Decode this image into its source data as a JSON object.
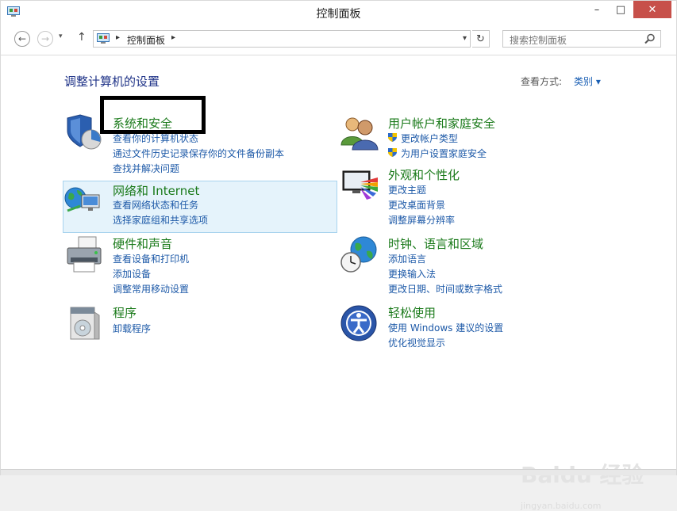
{
  "window": {
    "title": "控制面板"
  },
  "titlebar": {
    "minimize": "–",
    "maximize": "□",
    "close": "✕"
  },
  "address": {
    "back": "←",
    "forward": "→",
    "dropdown": "▾",
    "up": "↑",
    "path": "控制面板",
    "sep": "▸",
    "refresh": "↻"
  },
  "search": {
    "placeholder": "搜索控制面板"
  },
  "main": {
    "heading": "调整计算机的设置",
    "view_by_label": "查看方式:",
    "view_by_value": "类别 ▾"
  },
  "categories": {
    "system": {
      "title": "系统和安全",
      "links": [
        "查看你的计算机状态",
        "通过文件历史记录保存你的文件备份副本",
        "查找并解决问题"
      ]
    },
    "network": {
      "title": "网络和 Internet",
      "links": [
        "查看网络状态和任务",
        "选择家庭组和共享选项"
      ]
    },
    "hardware": {
      "title": "硬件和声音",
      "links": [
        "查看设备和打印机",
        "添加设备",
        "调整常用移动设置"
      ]
    },
    "programs": {
      "title": "程序",
      "links": [
        "卸载程序"
      ]
    },
    "users": {
      "title": "用户帐户和家庭安全",
      "links": [
        "更改帐户类型",
        "为用户设置家庭安全"
      ]
    },
    "appearance": {
      "title": "外观和个性化",
      "links": [
        "更改主题",
        "更改桌面背景",
        "调整屏幕分辨率"
      ]
    },
    "clock": {
      "title": "时钟、语言和区域",
      "links": [
        "添加语言",
        "更换输入法",
        "更改日期、时间或数字格式"
      ]
    },
    "ease": {
      "title": "轻松使用",
      "links": [
        "使用 Windows 建议的设置",
        "优化视觉显示"
      ]
    }
  },
  "watermark": {
    "brand": "Baidu 经验",
    "url": "jingyan.baidu.com"
  },
  "colors": {
    "link": "#1e5aa8",
    "category": "#1a7a1a",
    "heading": "#1e3287",
    "close": "#c7504a",
    "highlight": "#e5f3fb"
  }
}
